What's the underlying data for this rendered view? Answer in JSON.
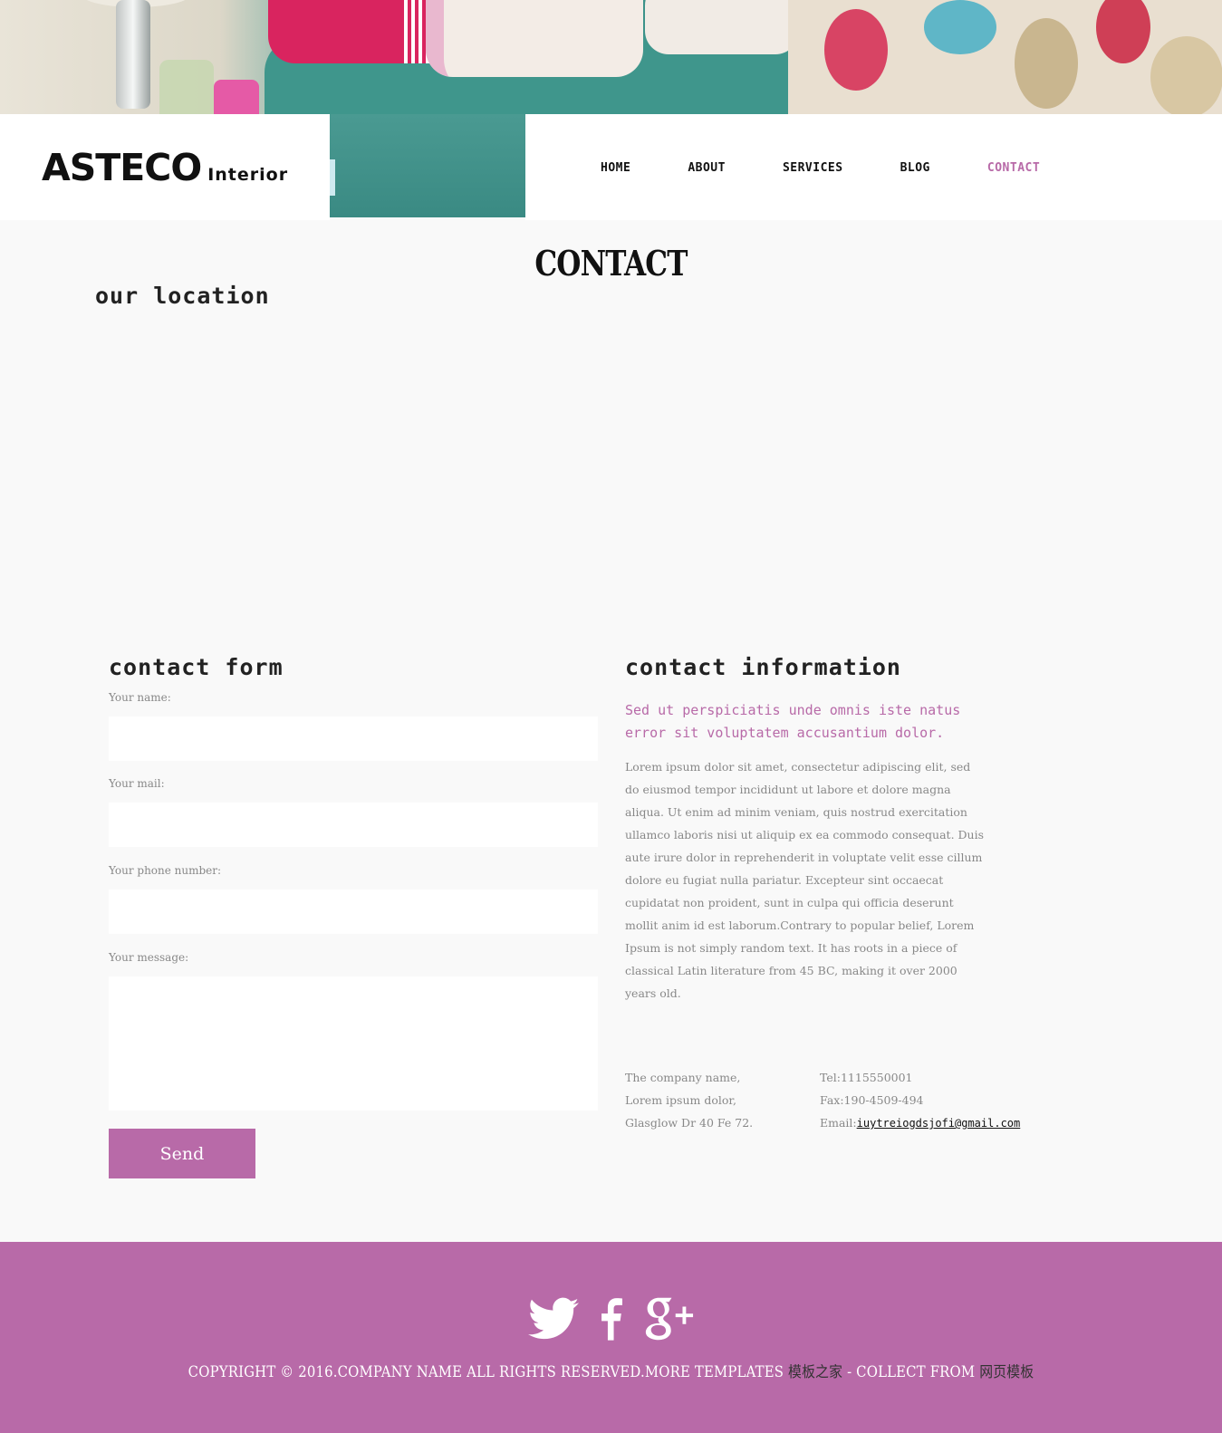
{
  "brand": {
    "name": "ASTECO",
    "suffix": "Interior"
  },
  "nav": {
    "items": [
      {
        "label": "HOME"
      },
      {
        "label": "ABOUT"
      },
      {
        "label": "SERVICES"
      },
      {
        "label": "BLOG"
      },
      {
        "label": "CONTACT",
        "active": true
      }
    ]
  },
  "page": {
    "title": "CONTACT"
  },
  "location": {
    "title": "our location"
  },
  "form": {
    "title": "contact form",
    "name_label": "Your name:",
    "name_value": "",
    "mail_label": "Your mail:",
    "mail_value": "",
    "phone_label": "Your phone number:",
    "phone_value": "",
    "message_label": "Your message:",
    "message_value": "",
    "send_label": "Send"
  },
  "info": {
    "title": "contact information",
    "lead": "Sed ut perspiciatis unde omnis iste natus error sit voluptatem accusantium dolor.",
    "body": "Lorem ipsum dolor sit amet, consectetur adipiscing elit, sed do eiusmod tempor incididunt ut labore et dolore magna aliqua. Ut enim ad minim veniam, quis nostrud exercitation ullamco laboris nisi ut aliquip ex ea commodo consequat. Duis aute irure dolor in reprehenderit in voluptate velit esse cillum dolore eu fugiat nulla pariatur. Excepteur sint occaecat cupidatat non proident, sunt in culpa qui officia deserunt mollit anim id est laborum.Contrary to popular belief, Lorem Ipsum is not simply random text. It has roots in a piece of classical Latin literature from 45 BC, making it over 2000 years old.",
    "address": [
      "The company name,",
      "Lorem ipsum dolor,",
      "Glasglow Dr 40 Fe 72."
    ],
    "tel": "Tel:1115550001",
    "fax": "Fax:190-4509-494",
    "email_label": "Email:",
    "email_value": "iuytreiogdsjofi@gmail.com"
  },
  "footer": {
    "social_icons": [
      "twitter-icon",
      "facebook-icon",
      "google-plus-icon"
    ],
    "copyright_prefix": "COPYRIGHT © 2016.COMPANY NAME ALL RIGHTS RESERVED.MORE TEMPLATES ",
    "link1": "模板之家",
    "copyright_mid": " - COLLECT FROM ",
    "link2": "网页模板"
  },
  "colors": {
    "accent": "#b86aa8",
    "background": "#f9f9f9",
    "text": "#111111",
    "muted": "#888888"
  }
}
